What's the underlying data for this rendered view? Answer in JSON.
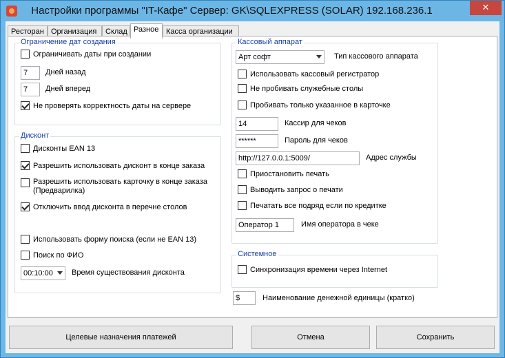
{
  "window": {
    "title": "Настройки программы \"IT-Кафе\"  Сервер: GK\\SQLEXPRESS (SOLAR) 192.168.236.1",
    "close_label": "✕"
  },
  "tabs": [
    {
      "label": "Ресторан"
    },
    {
      "label": "Организация"
    },
    {
      "label": "Склад"
    },
    {
      "label": "Разное"
    },
    {
      "label": "Касса организации"
    }
  ],
  "date_limit": {
    "title": "Ограничение дат создания",
    "limit_dates_label": "Ограничивать даты при создании",
    "limit_dates_checked": false,
    "days_back_value": "7",
    "days_back_label": "Дней назад",
    "days_forward_value": "7",
    "days_forward_label": "Дней вперед",
    "no_check_label": "Не проверять корректность даты на сервере",
    "no_check_checked": true
  },
  "discount": {
    "title": "Дисконт",
    "ean13_label": "Дисконты EAN 13",
    "ean13_checked": false,
    "allow_end_label": "Разрешить использовать дисконт в конце заказа",
    "allow_end_checked": true,
    "allow_card_label_1": "Разрешить использовать карточку в конце заказа",
    "allow_card_label_2": "(Предварилка)",
    "allow_card_checked": false,
    "disable_in_tables_label": "Отключить ввод дисконта в перечне столов",
    "disable_in_tables_checked": true,
    "search_form_label": "Использовать форму поиска (если не EAN 13)",
    "search_form_checked": false,
    "search_fio_label": "Поиск по ФИО",
    "search_fio_checked": false,
    "lifetime_value": "00:10:00",
    "lifetime_label": "Время существования дисконта"
  },
  "cash": {
    "title": "Кассовый аппарат",
    "device_value": "Арт софт",
    "device_label": "Тип кассового аппарата",
    "use_register_label": "Использовать кассовый регистратор",
    "use_register_checked": false,
    "no_service_tables_label": "Не пробивать служебные столы",
    "no_service_tables_checked": false,
    "only_in_card_label": "Пробивать только указанное в карточке",
    "only_in_card_checked": false,
    "cashier_value": "14",
    "cashier_label": "Кассир для чеков",
    "password_value": "******",
    "password_label": "Пароль для чеков",
    "service_url_value": "http://127.0.0.1:5009/",
    "service_url_label": "Адрес службы",
    "pause_print_label": "Приостановить печать",
    "pause_print_checked": false,
    "print_prompt_label": "Выводить запрос о печати",
    "print_prompt_checked": false,
    "print_all_credit_label": "Печатать все подряд если по кредитке",
    "print_all_credit_checked": false,
    "operator_value": "Оператор 1",
    "operator_label": "Имя оператора в чеке"
  },
  "system": {
    "title": "Системное",
    "sync_time_label": "Синхронизация времени через Internet",
    "sync_time_checked": false
  },
  "currency": {
    "value": "$",
    "label": "Наименование денежной единицы (кратко)"
  },
  "buttons": {
    "payment_purposes": "Целевые назначения платежей",
    "cancel": "Отмена",
    "save": "Сохранить"
  }
}
